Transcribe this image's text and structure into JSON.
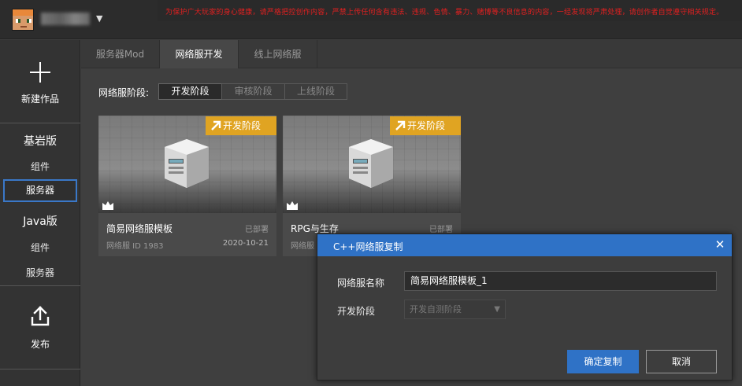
{
  "topbar": {
    "notice": "为保护广大玩家的身心健康，请严格把控创作内容，严禁上传任何含有违法、违规、色情、暴力、赌博等不良信息的内容，一经发现将严肃处理，请创作者自觉遵守相关规定。"
  },
  "sidebar": {
    "new_work": "新建作品",
    "bedrock": "基岩版",
    "bedrock_items": [
      "组件",
      "服务器"
    ],
    "java": "Java版",
    "java_items": [
      "组件",
      "服务器"
    ],
    "publish": "发布"
  },
  "tabs": [
    "服务器Mod",
    "网络服开发",
    "线上网络服"
  ],
  "stage_filter": {
    "label": "网络服阶段:",
    "options": [
      "开发阶段",
      "审核阶段",
      "上线阶段"
    ]
  },
  "cards": [
    {
      "badge": "开发阶段",
      "title": "简易网络服模板",
      "status": "已部署",
      "meta": "网络服 ID 1983",
      "date": "2020-10-21"
    },
    {
      "badge": "开发阶段",
      "title": "RPG与生存",
      "status": "已部署",
      "meta": "网络服"
    }
  ],
  "dialog": {
    "title": "C++网络服复制",
    "name_label": "网络服名称",
    "name_value": "简易网络服模板_1",
    "stage_label": "开发阶段",
    "stage_value": "开发自测阶段",
    "confirm": "确定复制",
    "cancel": "取消"
  }
}
